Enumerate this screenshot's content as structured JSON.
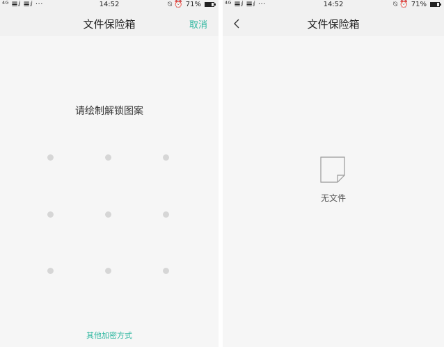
{
  "left_screen": {
    "status": {
      "signal": "⁴ᴳ 𝌆ⅈ 𝌆ⅈ ···",
      "time": "14:52",
      "icons": "⍉ ⏰",
      "battery": "71%",
      "battery_level": 0.71
    },
    "nav": {
      "title": "文件保险箱",
      "action": "取消"
    },
    "prompt": "请绘制解锁图案",
    "pattern_dots": 9,
    "alt_link": "其他加密方式"
  },
  "right_screen": {
    "status": {
      "signal": "⁴ᴳ 𝌆ⅈ 𝌆ⅈ ···",
      "time": "14:52",
      "icons": "⍉ ⏰",
      "battery": "71%",
      "battery_level": 0.71
    },
    "nav": {
      "title": "文件保险箱",
      "back_icon": "chevron-left-icon"
    },
    "empty_icon": "blank-file-icon",
    "empty_text": "无文件"
  },
  "colors": {
    "accent": "#2fb7a0",
    "background": "#f6f6f6",
    "bar": "#f1f1f1",
    "dot": "#d6d6d6"
  }
}
